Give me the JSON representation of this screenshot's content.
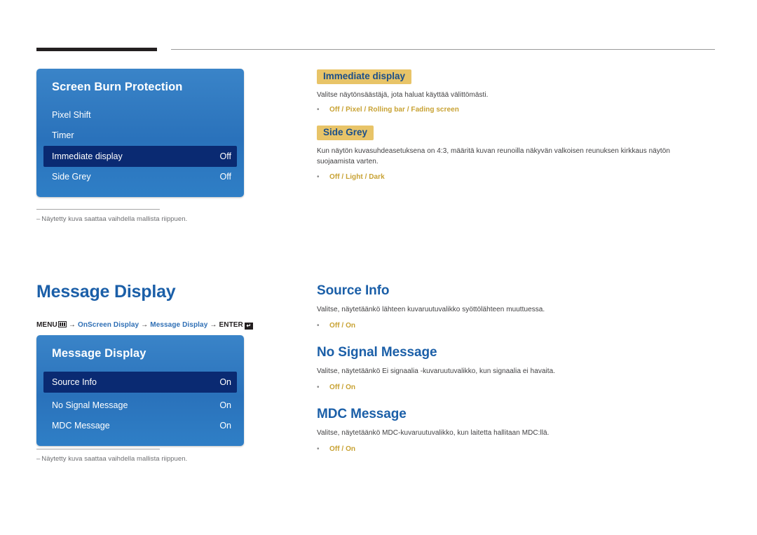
{
  "page": {
    "footnote_dash": "‒",
    "footnote_text": "Näytetty kuva saattaa vaihdella mallista riippuen."
  },
  "panel_screen_burn": {
    "title": "Screen Burn Protection",
    "rows": [
      {
        "label": "Pixel Shift",
        "value": "",
        "selected": false
      },
      {
        "label": "Timer",
        "value": "",
        "selected": false
      },
      {
        "label": "Immediate display",
        "value": "Off",
        "selected": true
      },
      {
        "label": "Side Grey",
        "value": "Off",
        "selected": false
      }
    ]
  },
  "panel_message_display": {
    "title": "Message Display",
    "rows": [
      {
        "label": "Source Info",
        "value": "On",
        "selected": true
      },
      {
        "label": "No Signal Message",
        "value": "On",
        "selected": false
      },
      {
        "label": "MDC Message",
        "value": "On",
        "selected": false
      }
    ]
  },
  "breadcrumb": {
    "menu": "MENU",
    "arrow": "→",
    "item1": "OnScreen Display",
    "item2": "Message Display",
    "enter": "ENTER",
    "enter_glyph": "↵"
  },
  "sections": [
    {
      "title": "Immediate display",
      "style": "highlight",
      "body": "Valitse näytönsäästäjä, jota haluat käyttää välittömästi.",
      "options": "Off / Pixel / Rolling bar / Fading screen"
    },
    {
      "title": "Side Grey",
      "style": "highlight",
      "body": "Kun näytön kuvasuhdeasetuksena on 4:3, määritä kuvan reunoilla näkyvän valkoisen reunuksen kirkkaus näytön suojaamista varten.",
      "options": "Off / Light / Dark"
    },
    {
      "title": "Source Info",
      "style": "h2",
      "body": "Valitse, näytetäänkö lähteen kuvaruutuvalikko syöttölähteen muuttuessa.",
      "options": "Off / On"
    },
    {
      "title": "No Signal Message",
      "style": "h2",
      "body": "Valitse, näytetäänkö Ei signaalia -kuvaruutuvalikko, kun signaalia ei havaita.",
      "options": "Off / On"
    },
    {
      "title": "MDC Message",
      "style": "h2",
      "body": "Valitse, näytetäänkö MDC-kuvaruutuvalikko, kun laitetta hallitaan MDC:llä.",
      "options": "Off / On"
    }
  ],
  "main_heading": "Message Display",
  "bullet": "•",
  "colors": {
    "panel_blue": "#2f7ec4",
    "selected_row": "#0a2a72",
    "heading_blue": "#1b5fa8",
    "highlight_bg": "#e8c468",
    "option_gold": "#c8a233"
  }
}
